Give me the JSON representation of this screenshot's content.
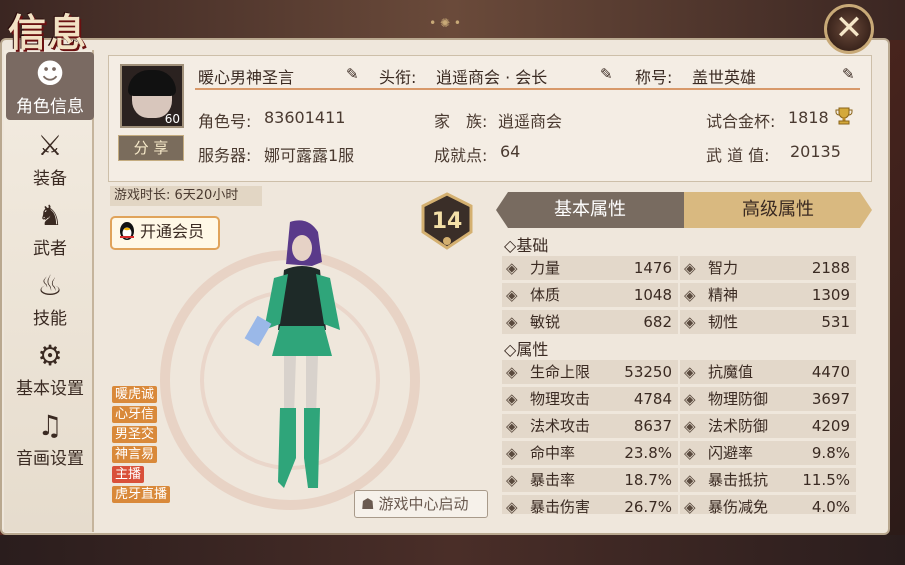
{
  "title": "信息",
  "close_label": "✕",
  "sidebar": {
    "items": [
      {
        "label": "角色信息",
        "icon": "character-info-icon",
        "active": true
      },
      {
        "label": "装备",
        "icon": "equipment-icon"
      },
      {
        "label": "武者",
        "icon": "warrior-icon"
      },
      {
        "label": "技能",
        "icon": "skill-icon"
      },
      {
        "label": "基本设置",
        "icon": "settings-gear-icon"
      },
      {
        "label": "音画设置",
        "icon": "audio-video-icon"
      }
    ]
  },
  "profile": {
    "avatar_level": "60",
    "name": "暖心男神圣言",
    "title_label": "头衔:",
    "title_value": "逍遥商会 · 会长",
    "nickname_label": "称号:",
    "nickname_value": "盖世英雄",
    "share_label": "分 享",
    "role_id_label": "角色号:",
    "role_id": "83601411",
    "family_label": "家　族:",
    "family": "逍遥商会",
    "trial_cup_label": "试合金杯:",
    "trial_cup": "1818",
    "server_label": "服务器:",
    "server": "娜可露露1服",
    "achievement_label": "成就点:",
    "achievement": "64",
    "martial_label": "武 道 值:",
    "martial": "20135"
  },
  "character": {
    "playtime": "游戏时长: 6天20小时",
    "vip_label": "开通会员",
    "level": "14",
    "tags": [
      {
        "text": "暖虎诚",
        "color": "#d9893a"
      },
      {
        "text": "心牙信",
        "color": "#d9893a"
      },
      {
        "text": "男圣交",
        "color": "#d9893a"
      },
      {
        "text": "神言易",
        "color": "#d9893a"
      },
      {
        "text": "主播",
        "color": "#d9503a"
      },
      {
        "text": "虎牙直播",
        "color": "#d9893a"
      }
    ],
    "game_center_label": "游戏中心启动"
  },
  "attributes": {
    "tab_basic": "基本属性",
    "tab_advanced": "高级属性",
    "section_basic": "基础",
    "section_attr": "属性",
    "basic": [
      {
        "name": "力量",
        "value": "1476"
      },
      {
        "name": "智力",
        "value": "2188"
      },
      {
        "name": "体质",
        "value": "1048"
      },
      {
        "name": "精神",
        "value": "1309"
      },
      {
        "name": "敏锐",
        "value": "682"
      },
      {
        "name": "韧性",
        "value": "531"
      }
    ],
    "props": [
      {
        "name": "生命上限",
        "value": "53250"
      },
      {
        "name": "抗魔值",
        "value": "4470"
      },
      {
        "name": "物理攻击",
        "value": "4784"
      },
      {
        "name": "物理防御",
        "value": "3697"
      },
      {
        "name": "法术攻击",
        "value": "8637"
      },
      {
        "name": "法术防御",
        "value": "4209"
      },
      {
        "name": "命中率",
        "value": "23.8%"
      },
      {
        "name": "闪避率",
        "value": "9.8%"
      },
      {
        "name": "暴击率",
        "value": "18.7%"
      },
      {
        "name": "暴击抵抗",
        "value": "11.5%"
      },
      {
        "name": "暴击伤害",
        "value": "26.7%"
      },
      {
        "name": "暴伤减免",
        "value": "4.0%"
      }
    ]
  }
}
